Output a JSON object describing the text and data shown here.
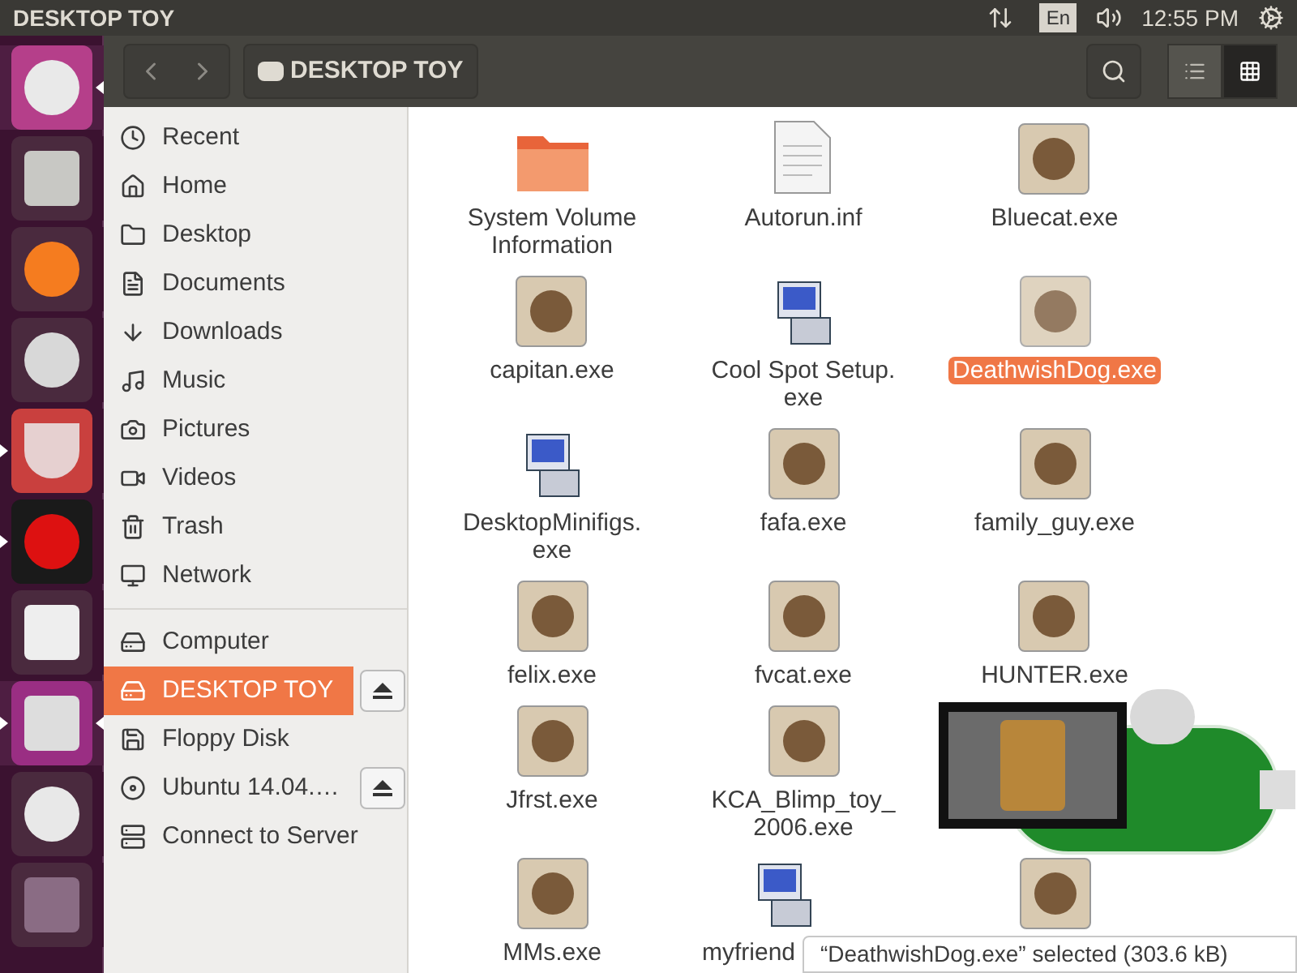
{
  "top_panel": {
    "title": "DESKTOP TOY",
    "keyboard": "En",
    "clock": "12:55 PM"
  },
  "launcher": [
    {
      "running": false,
      "focused": true
    },
    {
      "running": false,
      "focused": false
    },
    {
      "running": false,
      "focused": false
    },
    {
      "running": false,
      "focused": false
    },
    {
      "running": true,
      "focused": false
    },
    {
      "running": true,
      "focused": false
    },
    {
      "running": false,
      "focused": false
    },
    {
      "running": true,
      "focused": true
    },
    {
      "running": false,
      "focused": false
    },
    {
      "running": false,
      "focused": false
    }
  ],
  "header": {
    "path": "DESKTOP TOY",
    "views": [
      {
        "kind": "list",
        "selected": false
      },
      {
        "kind": "grid",
        "selected": true
      }
    ]
  },
  "sidebar": {
    "places": [
      {
        "label": "Recent",
        "selected": false
      },
      {
        "label": "Home",
        "selected": false
      },
      {
        "label": "Desktop",
        "selected": false
      },
      {
        "label": "Documents",
        "selected": false
      },
      {
        "label": "Downloads",
        "selected": false
      },
      {
        "label": "Music",
        "selected": false
      },
      {
        "label": "Pictures",
        "selected": false
      },
      {
        "label": "Videos",
        "selected": false
      },
      {
        "label": "Trash",
        "selected": false
      },
      {
        "label": "Network",
        "selected": false
      }
    ],
    "devices": [
      {
        "label": "Computer",
        "selected": false,
        "eject": false
      },
      {
        "label": "DESKTOP TOY",
        "selected": true,
        "eject": true
      },
      {
        "label": "Floppy Disk",
        "selected": false,
        "eject": false
      },
      {
        "label": "Ubuntu 14.04.…",
        "selected": false,
        "eject": true
      },
      {
        "label": "Connect to Server",
        "selected": false,
        "eject": false
      }
    ]
  },
  "files": [
    {
      "name": "System Volume Information",
      "kind": "folder",
      "selected": false
    },
    {
      "name": "Autorun.inf",
      "kind": "document",
      "selected": false
    },
    {
      "name": "Bluecat.exe",
      "kind": "program",
      "selected": false
    },
    {
      "name": "capitan.exe",
      "kind": "program",
      "selected": false
    },
    {
      "name": "Cool Spot Setup. exe",
      "kind": "installer",
      "selected": false
    },
    {
      "name": "DeathwishDog.exe",
      "kind": "program",
      "selected": true
    },
    {
      "name": "DesktopMinifigs. exe",
      "kind": "installer",
      "selected": false
    },
    {
      "name": "fafa.exe",
      "kind": "program",
      "selected": false
    },
    {
      "name": "family_guy.exe",
      "kind": "program",
      "selected": false
    },
    {
      "name": "felix.exe",
      "kind": "program",
      "selected": false
    },
    {
      "name": "fvcat.exe",
      "kind": "program",
      "selected": false
    },
    {
      "name": "HUNTER.exe",
      "kind": "program",
      "selected": false
    },
    {
      "name": "Jfrst.exe",
      "kind": "program",
      "selected": false
    },
    {
      "name": "KCA_Blimp_toy_ 2006.exe",
      "kind": "program",
      "selected": false
    },
    {
      "kind": "hidden"
    },
    {
      "name": "MMs.exe",
      "kind": "program",
      "selected": false
    },
    {
      "name": "myfriend",
      "kind": "installer",
      "selected": false,
      "cut": true
    },
    {
      "kind": "program",
      "selected": false
    }
  ],
  "status": "“DeathwishDog.exe” selected  (303.6 kB)"
}
